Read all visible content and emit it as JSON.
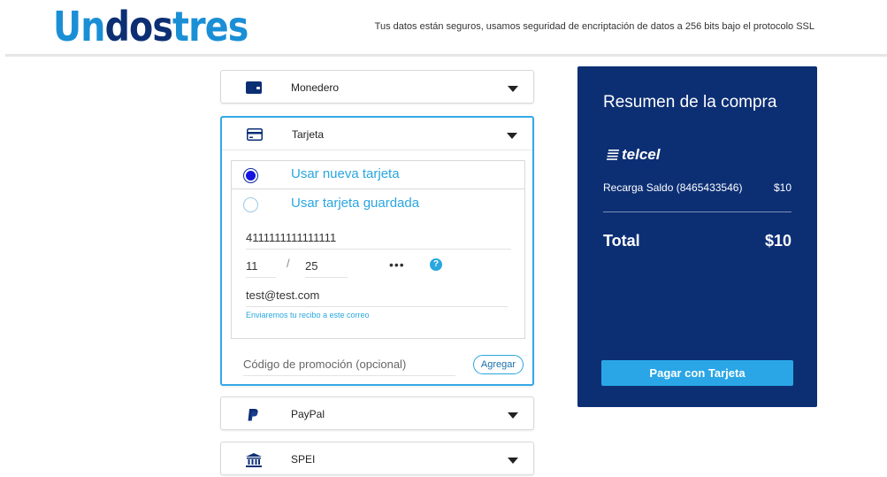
{
  "header": {
    "logo_part1": "Un",
    "logo_part2": "dos",
    "logo_part3": "tres",
    "security_text": "Tus datos están seguros, usamos seguridad de encriptación de datos a 256 bits bajo el protocolo SSL"
  },
  "payment_methods": {
    "monedero": {
      "label": "Monedero",
      "icon": "wallet-icon"
    },
    "tarjeta": {
      "label": "Tarjeta",
      "icon": "credit-card-icon",
      "options": [
        {
          "label": "Usar nueva tarjeta",
          "selected": true
        },
        {
          "label": "Usar tarjeta guardada",
          "selected": false
        }
      ],
      "card_number": "4111111111111111",
      "exp_month": "11",
      "exp_separator": "/",
      "exp_year": "25",
      "cvv_masked": "•••",
      "help_symbol": "?",
      "email": "test@test.com",
      "email_note": "Enviaremos tu recibo a este correo",
      "promo_placeholder": "Código de promoción (opcional)",
      "promo_button": "Agregar"
    },
    "paypal": {
      "label": "PayPal",
      "icon": "paypal-icon"
    },
    "spei": {
      "label": "SPEI",
      "icon": "bank-icon"
    }
  },
  "summary": {
    "title": "Resumen de la compra",
    "carrier": "telcel",
    "item_label": "Recarga Saldo (8465433546)",
    "item_price": "$10",
    "total_label": "Total",
    "total_price": "$10",
    "pay_button": "Pagar con Tarjeta"
  },
  "colors": {
    "brand_blue": "#1a8fd6",
    "brand_navy": "#0c2f74",
    "accent": "#2aa6df",
    "radio_selected": "#1414e0"
  }
}
